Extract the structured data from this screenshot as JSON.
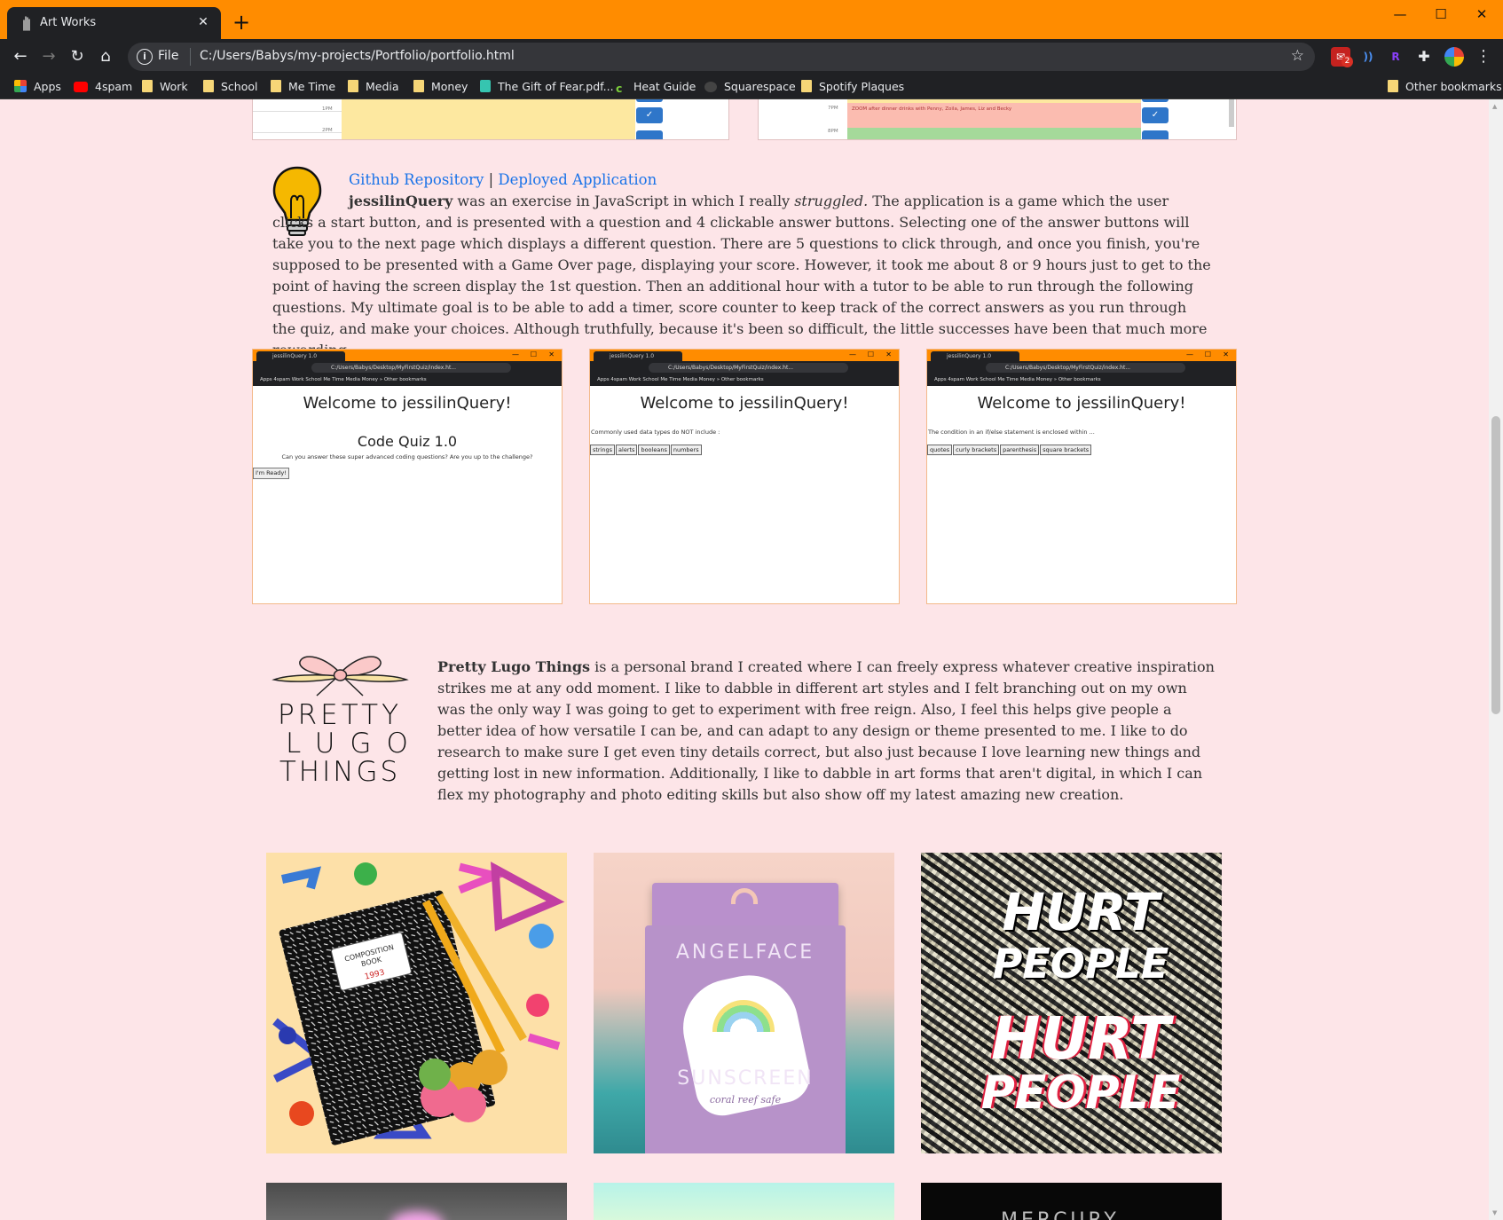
{
  "browser": {
    "tab_title": "Art Works",
    "new_tab": "+",
    "scheme": "File",
    "url": "C:/Users/Babys/my-projects/Portfolio/portfolio.html",
    "bookmarks": [
      "Apps",
      "4spam",
      "Work",
      "School",
      "Me Time",
      "Media",
      "Money",
      "The Gift of Fear.pdf...",
      "Heat Guide",
      "Squarespace",
      "Spotify Plaques"
    ],
    "other_bookmarks": "Other bookmarks",
    "gmail_badge": "2"
  },
  "calendar": {
    "left_times": [
      "1PM",
      "2PM"
    ],
    "right_times": [
      "7PM",
      "8PM"
    ],
    "right_event": "ZOOM after dinner drinks with Penny, Zoila, James, Liz and Becky"
  },
  "quiz_project": {
    "github_link": "Github Repository",
    "separator": "|",
    "deployed_link": "Deployed Application",
    "name": "jessilinQuery",
    "desc_a": " was an exercise in JavaScript in which I really ",
    "emph": "struggled.",
    "desc_b": " The application is a game which the user clicks a start button, and is presented with a question and 4 clickable answer buttons. Selecting one of the answer buttons will take you to the next page which displays a different question. There are 5 questions to click through, and once you finish, you're supposed to be presented with a Game Over page, displaying your score. However, it took me about 8 or 9 hours just to get to the point of having the screen display the 1st question. Then an additional hour with a tutor to be able to run through the following questions. My ultimate goal is to be able to add a timer, score counter to keep track of the correct answers as you run through the quiz, and make your choices. Although truthfully, because it's been so difficult, the little successes have been that much more rewarding."
  },
  "screens": {
    "tab": "jessilinQuery 1.0",
    "url": "C:/Users/Babys/Desktop/MyFirstQuiz/index.ht...",
    "bookmarks": "Apps   4spam   Work   School   Me Time   Media   Money          »   Other bookmarks",
    "welcome": "Welcome to jessilinQuery!",
    "s1_title": "Code Quiz 1.0",
    "s1_sub": "Can you answer these super advanced coding questions? Are you up to the challenge?",
    "s1_button": "I'm Ready!",
    "s2_question": "Commonly used data types do NOT include :",
    "s2_answers": [
      "strings",
      "alerts",
      "booleans",
      "numbers"
    ],
    "s3_question": "The condition in an if/else statement is enclosed within ...",
    "s3_answers": [
      "quotes",
      "curly brackets",
      "parenthesis",
      "square brackets"
    ]
  },
  "brand": {
    "logo_lines": [
      "PRETTY",
      "LUGO",
      "THINGS"
    ],
    "name": "Pretty Lugo Things",
    "desc": " is a personal brand I created where I can freely express whatever creative inspiration strikes me at any odd moment. I like to dabble in different art styles and I felt branching out on my own was the only way I was going to get to experiment with free reign. Also, I feel this helps give people a better idea of how versatile I can be, and can adapt to any design or theme presented to me. I like to do research to make sure I get even tiny details correct, but also just because I love learning new things and getting lost in new information. Additionally, I like to dabble in art forms that aren't digital, in which I can flex my photography and photo editing skills but also show off my latest amazing new creation."
  },
  "artworks": {
    "notebook_label_1": "COMPOSITION",
    "notebook_label_2": "BOOK",
    "notebook_year": "1993",
    "angelface_top": "ANGELFACE",
    "angelface_bottom": "SUNSCREEN",
    "angelface_script": "coral reef safe",
    "hurt_1": "HURT",
    "hurt_2": "PEOPLE",
    "hurt_3": "HURT",
    "hurt_4": "PEOPLE",
    "partial_text": "MERCURY"
  },
  "colors": {
    "accent_orange": "#ff8c00",
    "page_bg": "#fde5e8",
    "link": "#1a73e8"
  }
}
